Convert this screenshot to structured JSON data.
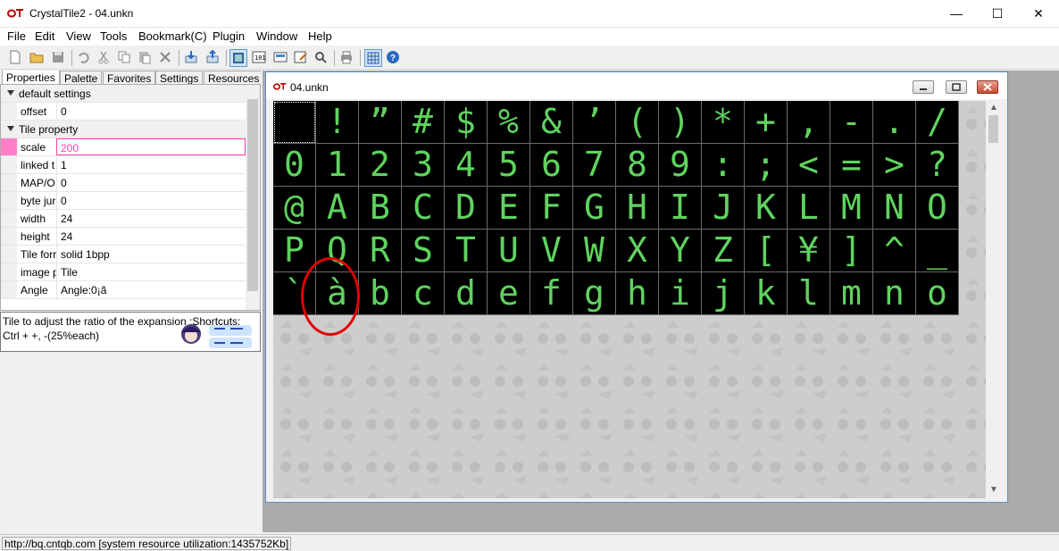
{
  "window": {
    "title": "CrystalTile2 - 04.unkn",
    "minimize_glyph": "—",
    "maximize_glyph": "☐",
    "close_glyph": "✕"
  },
  "menu": [
    {
      "label": "File"
    },
    {
      "label": "Edit"
    },
    {
      "label": "View"
    },
    {
      "label": "Tools"
    },
    {
      "label": "Bookmark(C)"
    },
    {
      "label": "Plugin"
    },
    {
      "label": "Window"
    },
    {
      "label": "Help"
    }
  ],
  "toolbar_icons": [
    "new-file-icon",
    "open-folder-icon",
    "save-icon",
    "undo-icon",
    "cut-icon",
    "copy-icon",
    "paste-icon",
    "delete-icon",
    "import-icon",
    "export-icon",
    "tile-view-icon",
    "hex-view-icon",
    "map-icon",
    "edit-icon",
    "search-icon",
    "print-icon",
    "grid-icon",
    "help-icon"
  ],
  "left_tabs": [
    {
      "label": "Properties"
    },
    {
      "label": "Palette"
    },
    {
      "label": "Favorites"
    },
    {
      "label": "Settings"
    },
    {
      "label": "Resources"
    }
  ],
  "properties": {
    "section1": "default settings",
    "offset": {
      "key": "offset",
      "value": "0"
    },
    "section2": "Tile property",
    "rows": [
      {
        "key": "scale",
        "value": "200"
      },
      {
        "key": "linked t",
        "value": "1"
      },
      {
        "key": "MAP/O",
        "value": "0"
      },
      {
        "key": "byte jur",
        "value": "0"
      },
      {
        "key": "width",
        "value": "24"
      },
      {
        "key": "height",
        "value": "24"
      },
      {
        "key": "Tile forr",
        "value": "solid 1bpp"
      },
      {
        "key": "image p",
        "value": "Tile"
      },
      {
        "key": "Angle",
        "value": "Angle:0¡ã"
      }
    ]
  },
  "description": "Tile to adjust the ratio of the expansion ;Shortcuts: Ctrl + +, -(25%each)",
  "child_window": {
    "title": "04.unkn"
  },
  "glyphs": [
    " ",
    "!",
    "”",
    "#",
    "$",
    "%",
    "&",
    "’",
    "(",
    ")",
    "*",
    "+",
    ",",
    "-",
    ".",
    "/",
    "0",
    "1",
    "2",
    "3",
    "4",
    "5",
    "6",
    "7",
    "8",
    "9",
    ":",
    ";",
    "<",
    "=",
    ">",
    "?",
    "@",
    "A",
    "B",
    "C",
    "D",
    "E",
    "F",
    "G",
    "H",
    "I",
    "J",
    "K",
    "L",
    "M",
    "N",
    "O",
    "P",
    "Q",
    "R",
    "S",
    "T",
    "U",
    "V",
    "W",
    "X",
    "Y",
    "Z",
    "[",
    "¥",
    "]",
    "^",
    "_",
    "`",
    "à",
    "b",
    "c",
    "d",
    "e",
    "f",
    "g",
    "h",
    "i",
    "j",
    "k",
    "l",
    "m",
    "n",
    "o"
  ],
  "status": "http://bq.cntqb.com [system resource utilization:1435752Kb]",
  "colors": {
    "glyph": "#5fd35f",
    "highlight": "#ff40b0",
    "annotation": "#e00000"
  }
}
